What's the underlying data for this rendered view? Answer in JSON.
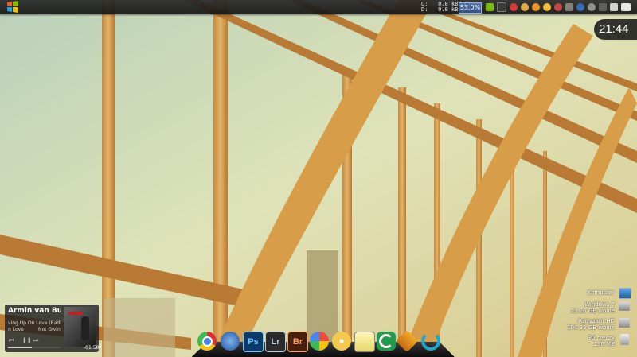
{
  "network": {
    "upload_label": "U:",
    "upload_value": "0.0 kB/s",
    "download_label": "D:",
    "download_value": "0.0 kB/s"
  },
  "cpu_meter": "53.0%",
  "clock": "21:44",
  "drives": [
    {
      "name": "Komputer",
      "info": ""
    },
    {
      "name": "Windows 7",
      "info": "23.26 GB wolne"
    },
    {
      "name": "Partyzant HD",
      "info": "194.35 GB wolne"
    },
    {
      "name": "30 rzeczy",
      "info": "136 MB"
    }
  ],
  "music_widget": {
    "artist": "Armin van Bu",
    "song": "ving Up On Love (Radi",
    "album_left": "n Love",
    "album_right": "Not Giving E",
    "time": "-01:58"
  },
  "dock_items": [
    {
      "name": "chrome",
      "label": ""
    },
    {
      "name": "thunderbird",
      "label": ""
    },
    {
      "name": "photoshop",
      "label": "Ps"
    },
    {
      "name": "lightroom",
      "label": "Lr"
    },
    {
      "name": "bridge",
      "label": "Br"
    },
    {
      "name": "picasa",
      "label": ""
    },
    {
      "name": "dvd",
      "label": ""
    },
    {
      "name": "notepad",
      "label": ""
    },
    {
      "name": "ccleaner",
      "label": ""
    },
    {
      "name": "winamp",
      "label": ""
    },
    {
      "name": "sync",
      "label": ""
    }
  ],
  "colors": {
    "sky": "#c9d9b0",
    "wood": "#d6a24c",
    "bar": "#1b1b1b"
  }
}
